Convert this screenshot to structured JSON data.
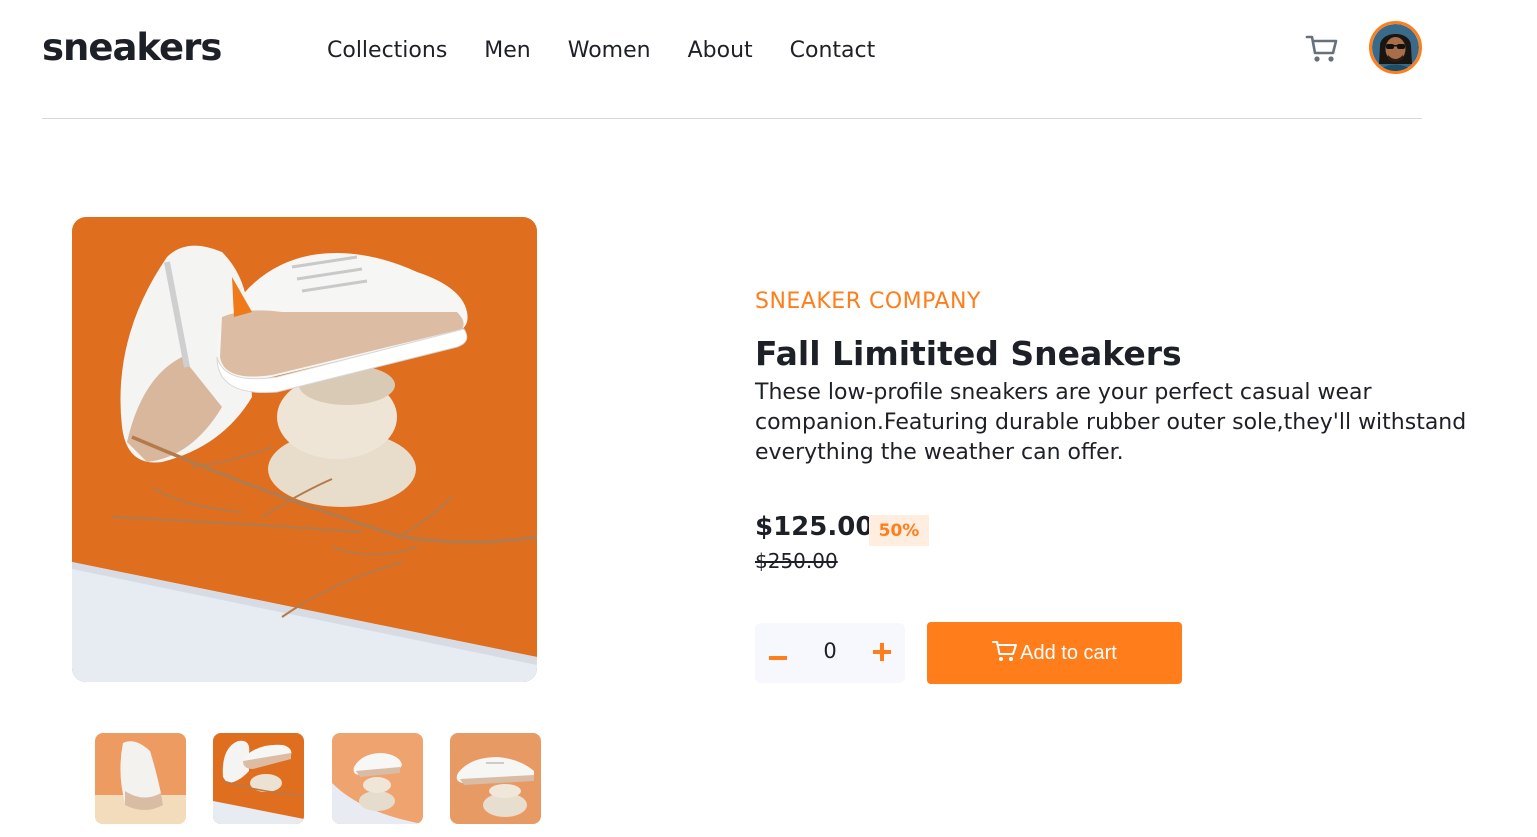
{
  "header": {
    "logo": "sneakers",
    "nav": [
      "Collections",
      "Men",
      "Women",
      "About",
      "Contact"
    ],
    "cart_icon": "cart-icon",
    "avatar": "user-avatar"
  },
  "gallery": {
    "main_image": "sneakers-on-stones-photo",
    "thumbnails": [
      "thumbnail-1",
      "thumbnail-2",
      "thumbnail-3",
      "thumbnail-4"
    ]
  },
  "product": {
    "company": "SNEAKER COMPANY",
    "title": "Fall Limitited Sneakers",
    "description": "These low-profile sneakers are your perfect casual wear companion.Featuring durable rubber outer sole,they'll withstand everything the weather can offer.",
    "price": "$125.00",
    "discount": "50%",
    "old_price": "$250.00"
  },
  "cart": {
    "quantity": "0",
    "add_label": "Add to cart"
  },
  "colors": {
    "accent": "#ff7e1b",
    "accent_pale": "#ffede0",
    "dark": "#1d2026",
    "qty_bg": "#f6f8fd"
  }
}
